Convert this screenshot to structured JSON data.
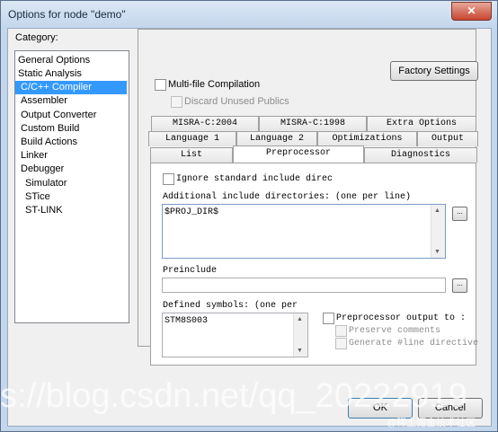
{
  "window": {
    "title": "Options for node \"demo\"",
    "close_glyph": "✕"
  },
  "category": {
    "label": "Category:",
    "items": [
      "General Options",
      "Static Analysis",
      "C/C++ Compiler",
      "Assembler",
      "Output Converter",
      "Custom Build",
      "Build Actions",
      "Linker",
      "Debugger",
      "Simulator",
      "STice",
      "ST-LINK"
    ],
    "selected": "C/C++ Compiler"
  },
  "panel": {
    "factory_settings": "Factory Settings",
    "multifile": "Multi-file Compilation",
    "discard": "Discard Unused Publics"
  },
  "tabs": {
    "row1": [
      "MISRA-C:2004",
      "MISRA-C:1998",
      "Extra Options"
    ],
    "row2": [
      "Language 1",
      "Language 2",
      "Optimizations",
      "Output"
    ],
    "row3": [
      "List",
      "Preprocessor",
      "Diagnostics"
    ],
    "active": "Preprocessor"
  },
  "preprocessor": {
    "ignore_std": "Ignore standard include direc",
    "add_include_label": "Additional include directories: (one per line)",
    "add_include_value": "$PROJ_DIR$",
    "preinclude_label": "Preinclude",
    "preinclude_value": "",
    "defined_label": "Defined symbols: (one per",
    "defined_value": "STM8S003",
    "pp_output": "Preprocessor output to :",
    "preserve": "Preserve comments",
    "generate": "Generate #line directive",
    "browse": "..."
  },
  "footer": {
    "ok": "OK",
    "cancel": "Cancel"
  },
  "watermark": {
    "main": "s://blog.csdn.net/qq_20222919",
    "sub": "@稀土掘金技术社区"
  }
}
